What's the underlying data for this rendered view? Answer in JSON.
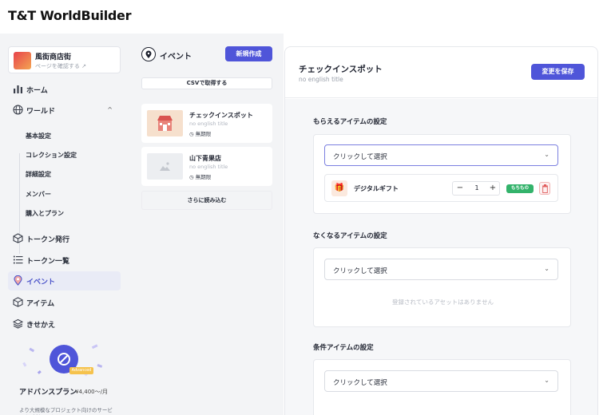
{
  "app": {
    "logo": "T&T WorldBuilder"
  },
  "sidebar": {
    "shop": {
      "name": "風街商店街",
      "link": "ページを確認する ↗"
    },
    "items": [
      {
        "label": "ホーム",
        "icon": "bar-chart-icon"
      },
      {
        "label": "ワールド",
        "icon": "globe-icon",
        "expanded_mark": "^"
      },
      {
        "label": "トークン発行",
        "icon": "cube-icon"
      },
      {
        "label": "トークン一覧",
        "icon": "list-icon"
      },
      {
        "label": "イベント",
        "icon": "pin-icon"
      },
      {
        "label": "アイテム",
        "icon": "box-icon"
      },
      {
        "label": "きせかえ",
        "icon": "layers-icon"
      }
    ],
    "world_sub": [
      "基本設定",
      "コレクション設定",
      "詳細設定",
      "メンバー",
      "購入とプラン"
    ],
    "promo": {
      "badge": "Advanced",
      "title": "アドバンスプラン",
      "price": "¥4,400〜/月",
      "desc": "より大規模なプロジェクト向けのサービスをご利用いただけます。"
    }
  },
  "events": {
    "title": "イベント",
    "new_button": "新規作成",
    "csv_button": "CSVで取得する",
    "cards": [
      {
        "title": "チェックインスポット",
        "subtitle": "no english title",
        "badge": "無期限"
      },
      {
        "title": "山下青果店",
        "subtitle": "no english title",
        "badge": "無期限"
      }
    ],
    "load_more": "さらに読み込む"
  },
  "detail": {
    "title": "チェックインスポット",
    "subtitle": "no english title",
    "save_button": "変更を保存",
    "sections": [
      {
        "title": "もらえるアイテムの設定",
        "placeholder": "クリックして選択"
      },
      {
        "title": "なくなるアイテムの設定",
        "placeholder": "クリックして選択",
        "empty": "登録されているアセットはありません"
      },
      {
        "title": "条件アイテムの設定",
        "placeholder": "クリックして選択"
      }
    ],
    "item": {
      "name": "デジタルギフト",
      "qty": "1",
      "tag": "もちもの",
      "minus": "−",
      "plus": "+"
    }
  },
  "colors": {
    "accent": "#4f55d9",
    "tag_green": "#33b36b",
    "sidebar_bg": "#f3f4f6"
  }
}
